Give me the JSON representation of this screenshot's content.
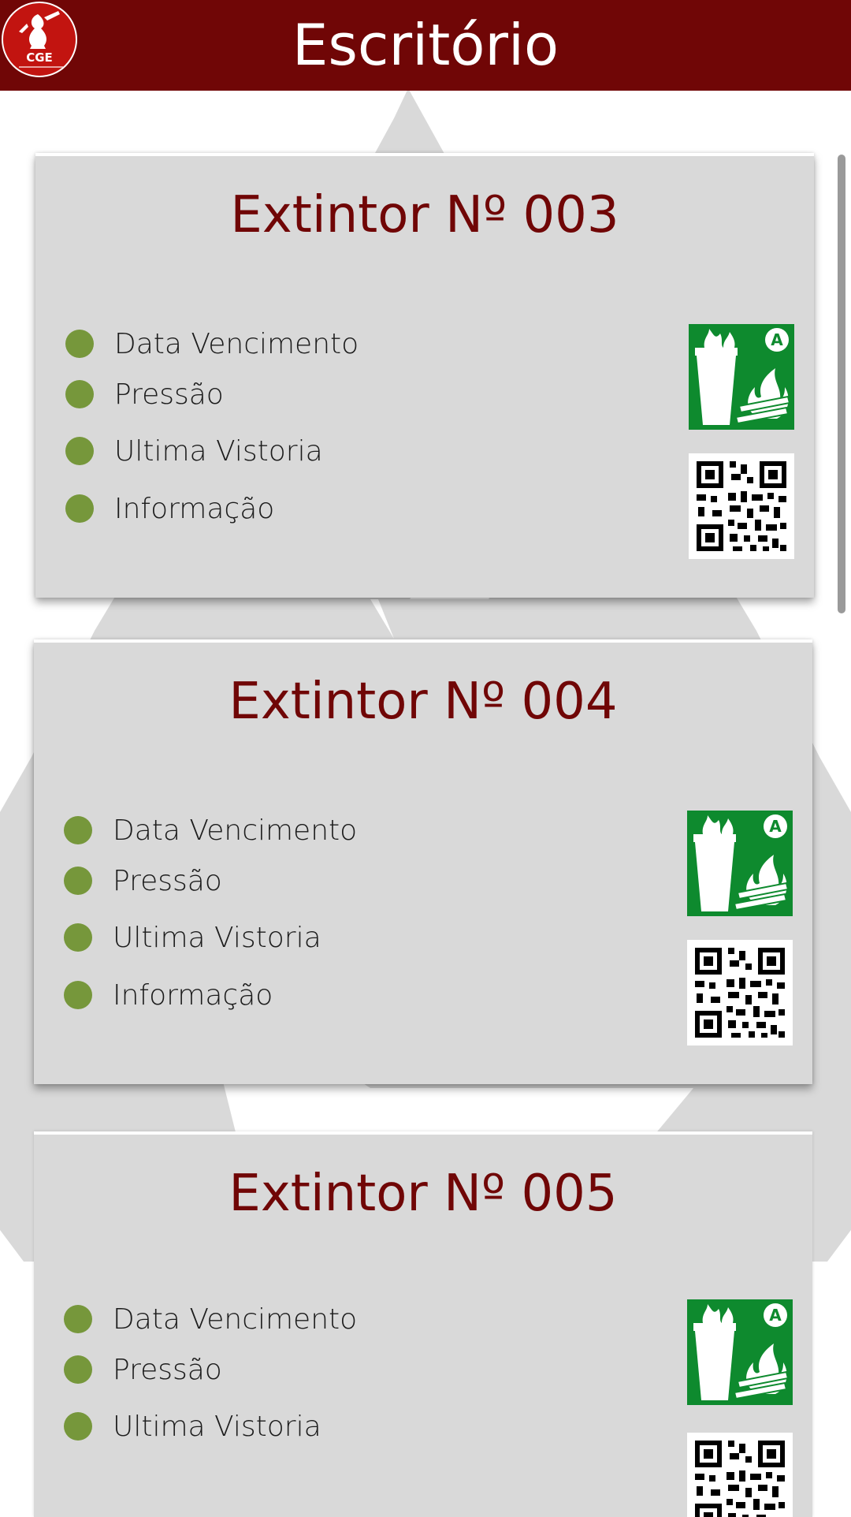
{
  "header": {
    "title": "Escritório",
    "logo_text": "CGE"
  },
  "cards": [
    {
      "title": "Extintor Nº 003",
      "items": [
        "Data Vencimento",
        "Pressão",
        "Ultima Vistoria",
        "Informação"
      ]
    },
    {
      "title": "Extintor Nº 004",
      "items": [
        "Data Vencimento",
        "Pressão",
        "Ultima Vistoria",
        "Informação"
      ]
    },
    {
      "title": "Extintor Nº 005",
      "items": [
        "Data Vencimento",
        "Pressão",
        "Ultima Vistoria"
      ]
    }
  ],
  "icons": {
    "logo": "fire-extinguisher-logo-icon",
    "class_sign": "fire-class-a-sign-icon",
    "qr": "qr-code-icon",
    "status_dot": "status-dot-icon"
  },
  "colors": {
    "header_bg": "#700606",
    "title_text": "#700606",
    "card_bg": "#d9d9d9",
    "dot": "#76973b",
    "sign_green": "#0e8a2e",
    "logo_red": "#c21410"
  }
}
